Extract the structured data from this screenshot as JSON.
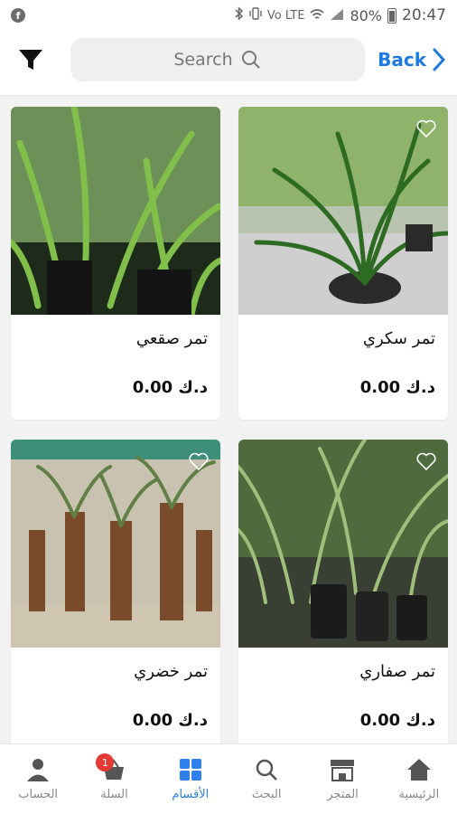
{
  "status_bar": {
    "battery": "80%",
    "time": "20:47",
    "network": "Vo LTE"
  },
  "header": {
    "search_placeholder": "Search",
    "back_label": "Back"
  },
  "products": [
    {
      "name": "تمر سكري",
      "price": "د.ك 0.00"
    },
    {
      "name": "تمر صقعي",
      "price": "د.ك 0.00"
    },
    {
      "name": "تمر صفاري",
      "price": "د.ك 0.00"
    },
    {
      "name": "تمر خضري",
      "price": "د.ك 0.00"
    }
  ],
  "nav": {
    "home": "الرئيسية",
    "store": "المتجر",
    "search": "البحث",
    "categories": "الأقسام",
    "cart": "السلة",
    "cart_count": "1",
    "account": "الحساب"
  },
  "colors": {
    "accent": "#2f80ed",
    "badge": "#e53935"
  }
}
